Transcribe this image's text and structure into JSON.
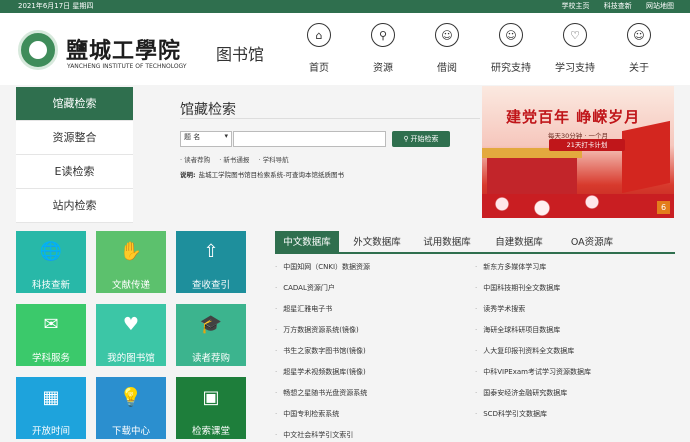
{
  "topbar": {
    "date": "2021年6月17日  星期四",
    "links": [
      "学校主页",
      "科技查新",
      "网站地图"
    ]
  },
  "header": {
    "school_name": "鹽城工學院",
    "school_name_en": "YANCHENG INSTITUTE OF TECHNOLOGY",
    "library_name": "图书馆"
  },
  "nav": [
    {
      "label": "首页",
      "icon": "home-icon",
      "glyph": "⌂"
    },
    {
      "label": "资源",
      "icon": "search-icon",
      "glyph": "⚲"
    },
    {
      "label": "借阅",
      "icon": "user-icon",
      "glyph": "☺"
    },
    {
      "label": "研究支持",
      "icon": "user-icon",
      "glyph": "☺"
    },
    {
      "label": "学习支持",
      "icon": "heart-icon",
      "glyph": "♡"
    },
    {
      "label": "关于",
      "icon": "user-icon",
      "glyph": "☺"
    }
  ],
  "sidebar": {
    "items": [
      "馆藏检索",
      "资源整合",
      "E读检索",
      "站内检索"
    ]
  },
  "search": {
    "title": "馆藏检索",
    "select_value": "题 名",
    "button_label": "开始检索",
    "quick_links": [
      "· 读者荐购",
      "· 新书通报",
      "· 学科导航"
    ],
    "note_label": "说明:",
    "note_text": "盐城工学院图书馆目检索系统-可查询本馆纸质图书"
  },
  "banner": {
    "title": "建党百年  峥嵘岁月",
    "subtitle": "每天30分钟 · 一个月",
    "plan": "21天打卡计划",
    "slide_number": "6"
  },
  "tiles": [
    {
      "label": "科技查新",
      "color": "#28b8a8",
      "icon": "globe-search-icon",
      "glyph": "🌐"
    },
    {
      "label": "文献传递",
      "color": "#5cc16d",
      "icon": "hand-document-icon",
      "glyph": "✋"
    },
    {
      "label": "查收查引",
      "color": "#1e8f9c",
      "icon": "upload-icon",
      "glyph": "⇧"
    },
    {
      "label": "学科服务",
      "color": "#3bc96b",
      "icon": "inbox-icon",
      "glyph": "✉"
    },
    {
      "label": "我的图书馆",
      "color": "#3cc6a6",
      "icon": "house-heart-icon",
      "glyph": "♥"
    },
    {
      "label": "读者荐购",
      "color": "#3cb48e",
      "icon": "graduation-cap-icon",
      "glyph": "🎓"
    },
    {
      "label": "开放时间",
      "color": "#1ea3dc",
      "icon": "calendar-icon",
      "glyph": "▦"
    },
    {
      "label": "下载中心",
      "color": "#2b8fcf",
      "icon": "lightbulb-icon",
      "glyph": "💡"
    },
    {
      "label": "检索课堂",
      "color": "#1e7e3b",
      "icon": "classroom-icon",
      "glyph": "▣"
    }
  ],
  "db": {
    "tabs": [
      "中文数据库",
      "外文数据库",
      "试用数据库",
      "自建数据库",
      "OA资源库"
    ],
    "left_items": [
      "中国知网（CNKI）数据资源",
      "CADAL资源门户",
      "超星汇雅电子书",
      "万方数据资源系统(镜像)",
      "书生之家数字图书馆(镜像)",
      "超星学术视频数据库(镜像)",
      "畅想之星随书光盘资源系统",
      "中国专利检索系统",
      "中文社会科学引文索引"
    ],
    "right_items": [
      "新东方多媒体学习库",
      "中国科技期刊全文数据库",
      "读秀学术搜索",
      "海研全球科研项目数据库",
      "人大复印报刊资料全文数据库",
      "中科VIPExam考试学习资源数据库",
      "国泰安经济金融研究数据库",
      "SCD科学引文数据库"
    ]
  }
}
